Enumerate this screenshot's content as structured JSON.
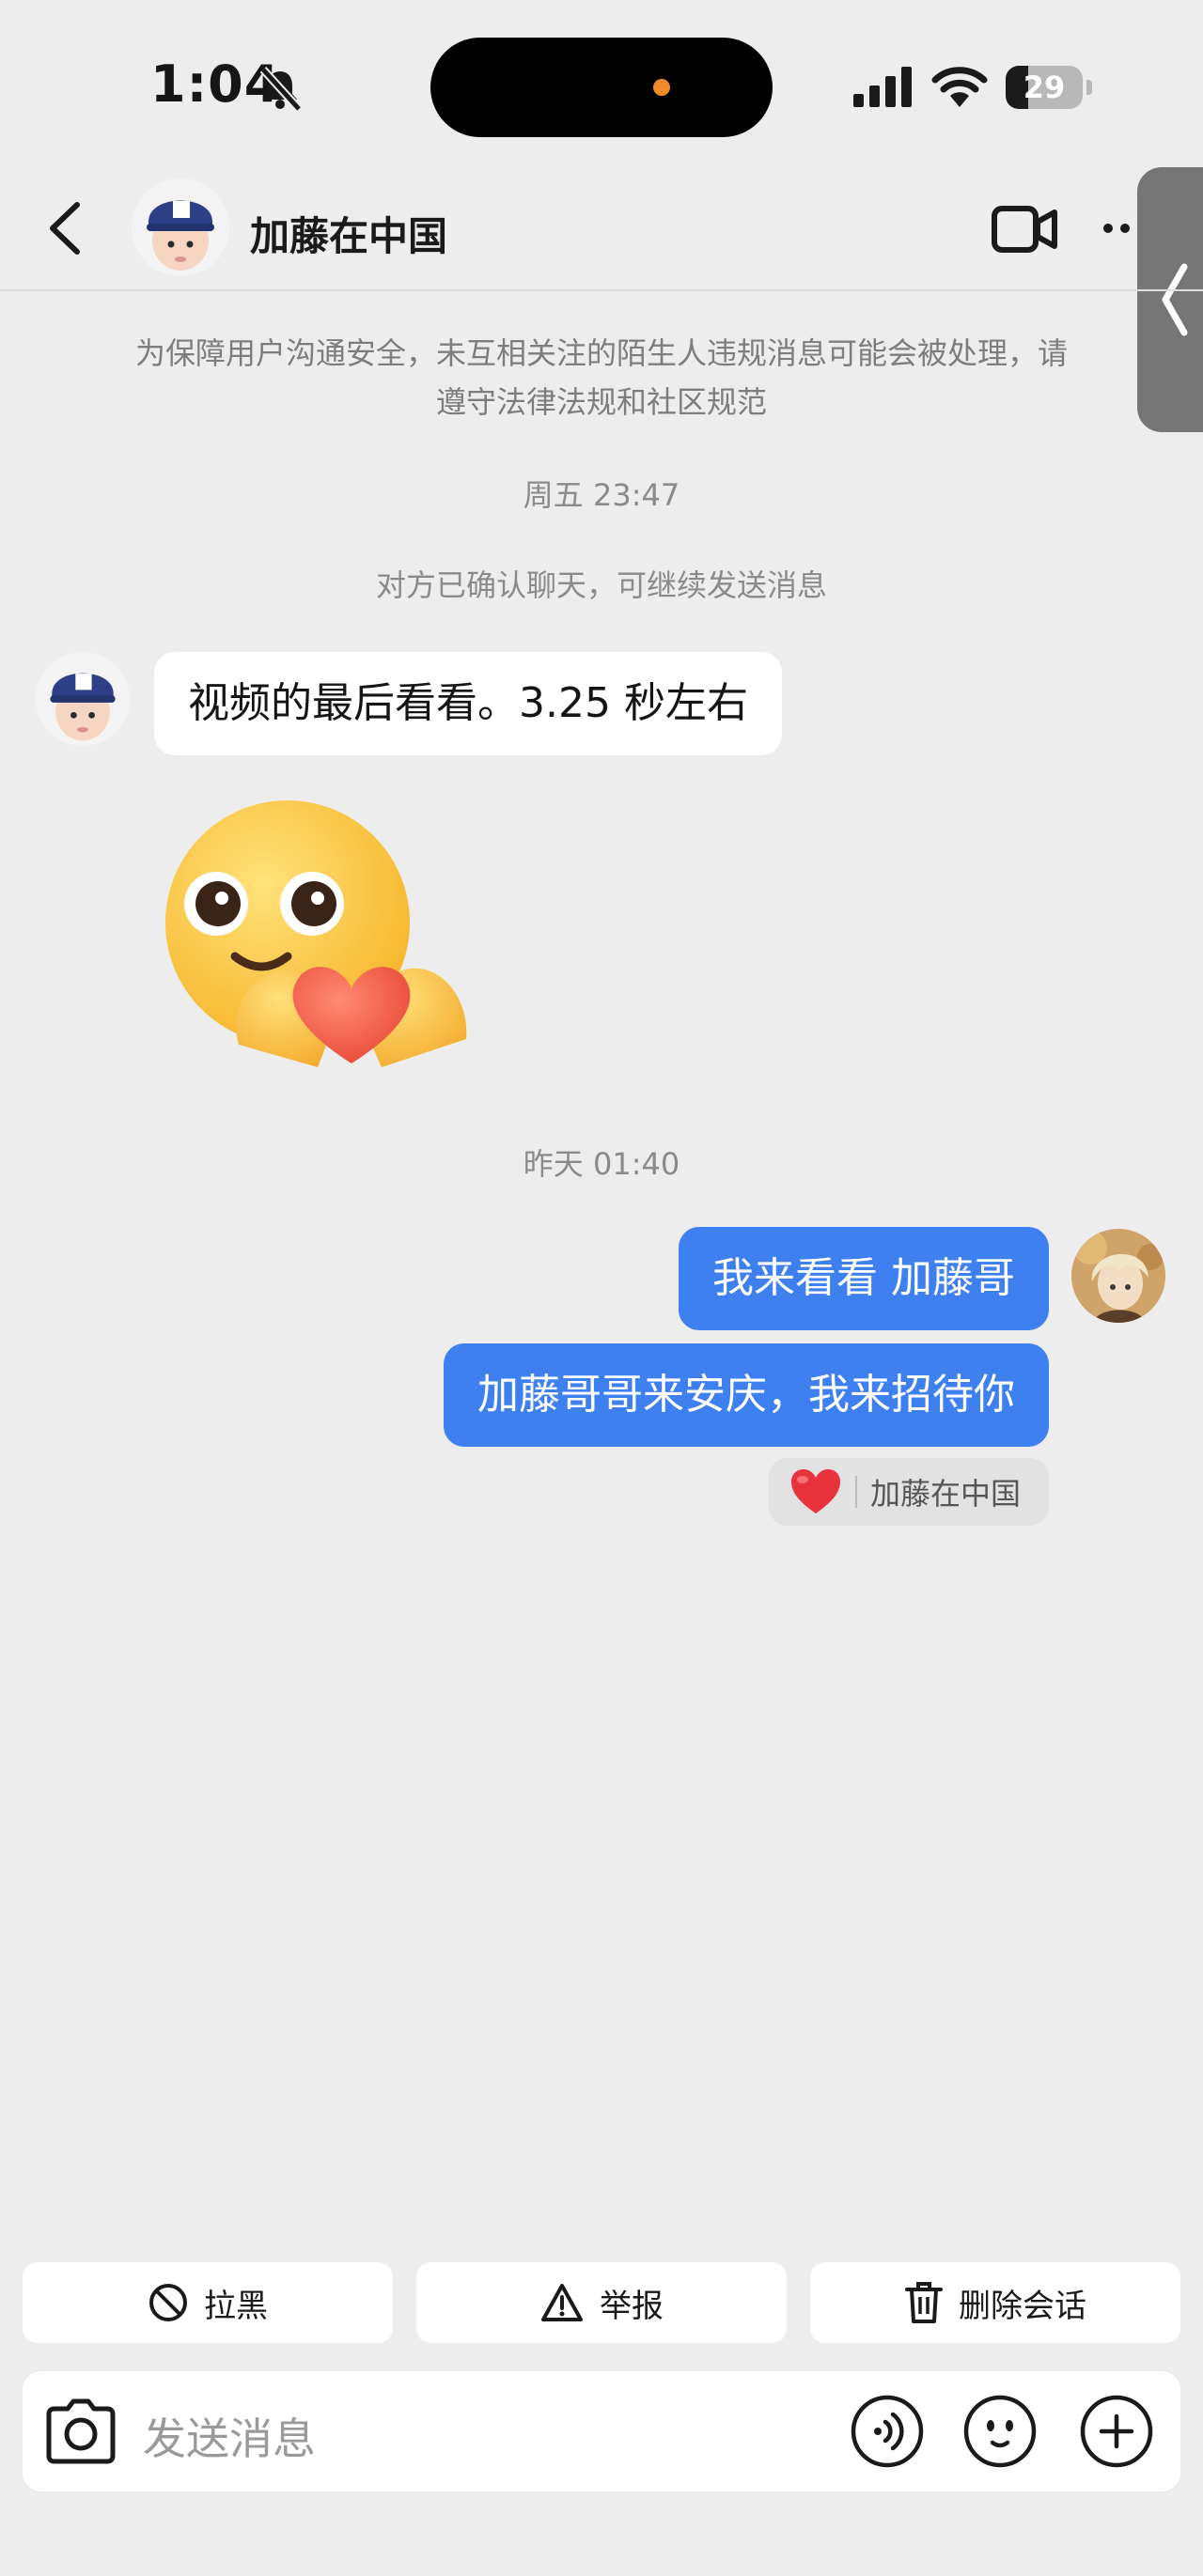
{
  "status_bar": {
    "time": "1:04",
    "battery": "29",
    "battery_level": 0.29
  },
  "header": {
    "contact_name": "加藤在中国"
  },
  "chat": {
    "safety_notice": "为保障用户沟通安全，未互相关注的陌生人违规消息可能会被处理，请遵守法律法规和社区规范",
    "timestamp_1": "周五 23:47",
    "confirm_notice": "对方已确认聊天，可继续发送消息",
    "incoming_message": "视频的最后看看。3.25 秒左右",
    "timestamp_2": "昨天 01:40",
    "outgoing_message_1": "我来看看 加藤哥",
    "outgoing_message_2": "加藤哥哥来安庆，我来招待你",
    "reaction_user": "加藤在中国"
  },
  "actions": {
    "block": "拉黑",
    "report": "举报",
    "delete": "删除会话"
  },
  "input": {
    "placeholder": "发送消息"
  },
  "colors": {
    "outgoing_bubble": "#3f80f1",
    "background": "#ededed"
  }
}
